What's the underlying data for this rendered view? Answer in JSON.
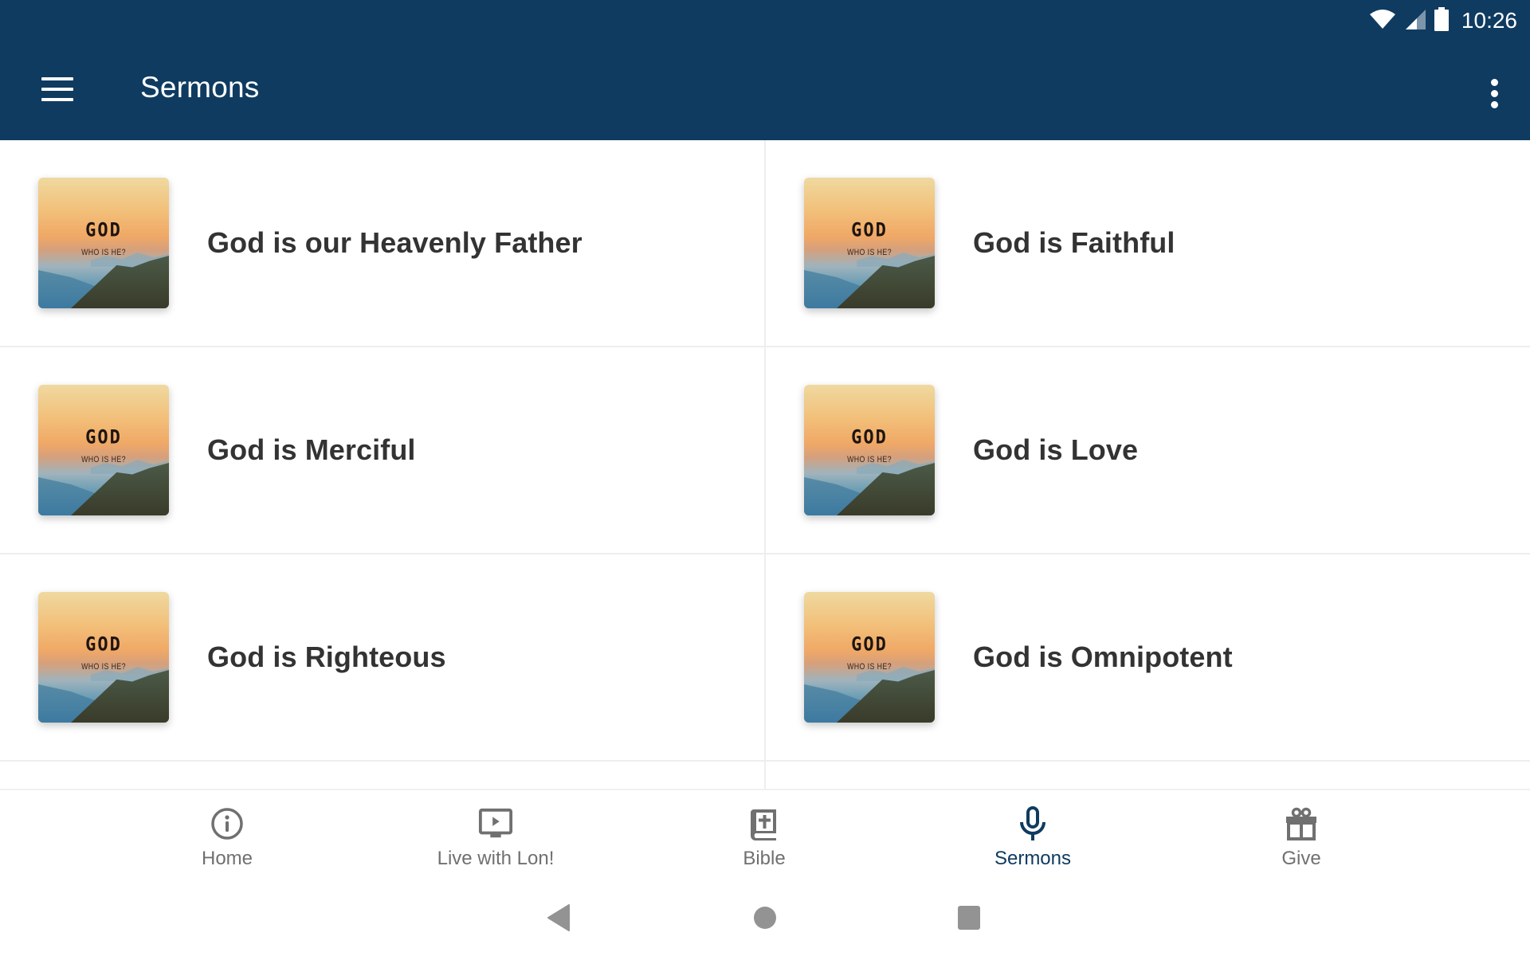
{
  "status_bar": {
    "time": "10:26",
    "icons": [
      "wifi-icon",
      "cellular-signal-icon",
      "battery-icon"
    ]
  },
  "app_bar": {
    "title": "Sermons",
    "menu_icon": "hamburger-menu-icon",
    "overflow_icon": "more-vertical-icon"
  },
  "colors": {
    "primary": "#0f3b60",
    "nav_inactive": "#707070",
    "title_text": "#333333"
  },
  "sermons": [
    {
      "title": "God is our Heavenly Father",
      "thumb_title": "GOD",
      "thumb_subtitle": "WHO IS HE?"
    },
    {
      "title": "God is Faithful",
      "thumb_title": "GOD",
      "thumb_subtitle": "WHO IS HE?"
    },
    {
      "title": "God is Merciful",
      "thumb_title": "GOD",
      "thumb_subtitle": "WHO IS HE?"
    },
    {
      "title": "God is Love",
      "thumb_title": "GOD",
      "thumb_subtitle": "WHO IS HE?"
    },
    {
      "title": "God is Righteous",
      "thumb_title": "GOD",
      "thumb_subtitle": "WHO IS HE?"
    },
    {
      "title": "God is Omnipotent",
      "thumb_title": "GOD",
      "thumb_subtitle": "WHO IS HE?"
    }
  ],
  "bottom_nav": {
    "items": [
      {
        "label": "Home",
        "icon": "info-circle-icon",
        "active": false
      },
      {
        "label": "Live with Lon!",
        "icon": "tv-play-icon",
        "active": false
      },
      {
        "label": "Bible",
        "icon": "bible-icon",
        "active": false
      },
      {
        "label": "Sermons",
        "icon": "microphone-icon",
        "active": true
      },
      {
        "label": "Give",
        "icon": "gift-icon",
        "active": false
      }
    ]
  },
  "system_nav": {
    "buttons": [
      "back-icon",
      "home-icon",
      "recents-icon"
    ]
  }
}
